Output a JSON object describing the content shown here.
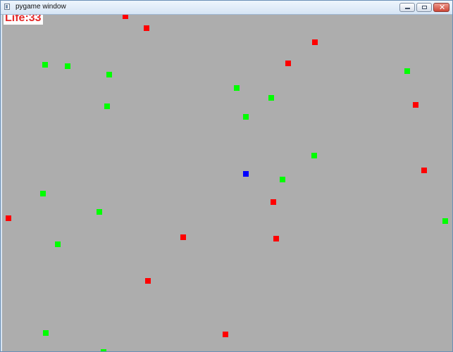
{
  "window": {
    "title": "pygame window",
    "icon": "app-icon",
    "controls": [
      {
        "name": "minimize-icon"
      },
      {
        "name": "maximize-icon"
      },
      {
        "name": "close-icon",
        "glyph": "✕"
      }
    ]
  },
  "game": {
    "background_color": "#adadad",
    "hud": {
      "life_text": "Life:33"
    },
    "colors": {
      "player": "#0000ff",
      "red": "#ff0000",
      "green": "#00ff00"
    }
  }
}
